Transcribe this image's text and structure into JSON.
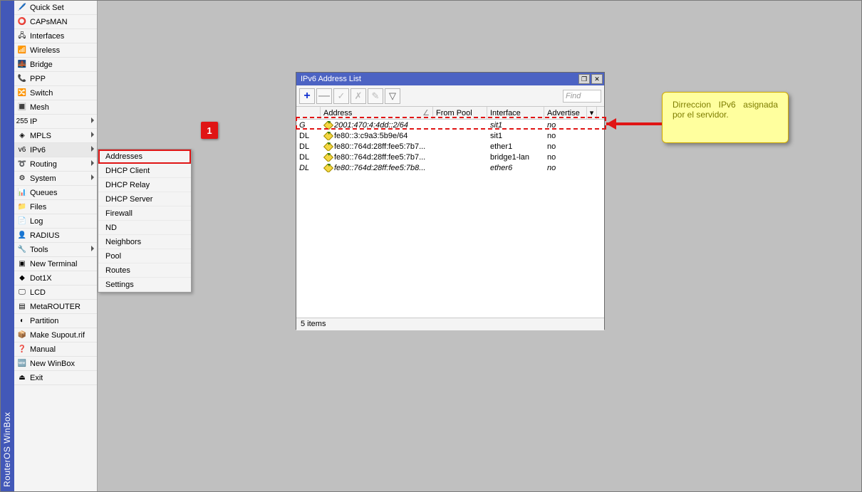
{
  "app_title": "RouterOS WinBox",
  "sidebar": {
    "items": [
      {
        "label": "Quick Set",
        "icon": "🖊️",
        "has_sub": false
      },
      {
        "label": "CAPsMAN",
        "icon": "⭕",
        "has_sub": false
      },
      {
        "label": "Interfaces",
        "icon": "🖧",
        "has_sub": false
      },
      {
        "label": "Wireless",
        "icon": "📶",
        "has_sub": false
      },
      {
        "label": "Bridge",
        "icon": "🌉",
        "has_sub": false
      },
      {
        "label": "PPP",
        "icon": "📞",
        "has_sub": false
      },
      {
        "label": "Switch",
        "icon": "🔀",
        "has_sub": false
      },
      {
        "label": "Mesh",
        "icon": "🔳",
        "has_sub": false
      },
      {
        "label": "IP",
        "icon": "255",
        "has_sub": true
      },
      {
        "label": "MPLS",
        "icon": "◈",
        "has_sub": true
      },
      {
        "label": "IPv6",
        "icon": "v6",
        "has_sub": true,
        "selected": true
      },
      {
        "label": "Routing",
        "icon": "➰",
        "has_sub": true
      },
      {
        "label": "System",
        "icon": "⚙",
        "has_sub": true
      },
      {
        "label": "Queues",
        "icon": "📊",
        "has_sub": false
      },
      {
        "label": "Files",
        "icon": "📁",
        "has_sub": false
      },
      {
        "label": "Log",
        "icon": "📄",
        "has_sub": false
      },
      {
        "label": "RADIUS",
        "icon": "👤",
        "has_sub": false
      },
      {
        "label": "Tools",
        "icon": "🔧",
        "has_sub": true
      },
      {
        "label": "New Terminal",
        "icon": "▣",
        "has_sub": false
      },
      {
        "label": "Dot1X",
        "icon": "◆",
        "has_sub": false
      },
      {
        "label": "LCD",
        "icon": "🖵",
        "has_sub": false
      },
      {
        "label": "MetaROUTER",
        "icon": "▤",
        "has_sub": false
      },
      {
        "label": "Partition",
        "icon": "◐",
        "has_sub": false
      },
      {
        "label": "Make Supout.rif",
        "icon": "📦",
        "has_sub": false
      },
      {
        "label": "Manual",
        "icon": "❓",
        "has_sub": false
      },
      {
        "label": "New WinBox",
        "icon": "🆕",
        "has_sub": false
      },
      {
        "label": "Exit",
        "icon": "⏏",
        "has_sub": false
      }
    ]
  },
  "submenu": {
    "items": [
      {
        "label": "Addresses",
        "highlight": true
      },
      {
        "label": "DHCP Client"
      },
      {
        "label": "DHCP Relay"
      },
      {
        "label": "DHCP Server"
      },
      {
        "label": "Firewall"
      },
      {
        "label": "ND"
      },
      {
        "label": "Neighbors"
      },
      {
        "label": "Pool"
      },
      {
        "label": "Routes"
      },
      {
        "label": "Settings"
      }
    ]
  },
  "ipwin": {
    "title": "IPv6 Address List",
    "find_placeholder": "Find",
    "columns": {
      "address": "Address",
      "from_pool": "From Pool",
      "interface": "Interface",
      "advertise": "Advertise"
    },
    "rows": [
      {
        "flag": "G",
        "address": "2001:470:4:4dd::2/64",
        "from_pool": "",
        "interface": "sit1",
        "advertise": "no",
        "italic": true
      },
      {
        "flag": "DL",
        "address": "fe80::3:c9a3:5b9e/64",
        "from_pool": "",
        "interface": "sit1",
        "advertise": "no"
      },
      {
        "flag": "DL",
        "address": "fe80::764d:28ff:fee5:7b7...",
        "from_pool": "",
        "interface": "ether1",
        "advertise": "no"
      },
      {
        "flag": "DL",
        "address": "fe80::764d:28ff:fee5:7b7...",
        "from_pool": "",
        "interface": "bridge1-lan",
        "advertise": "no"
      },
      {
        "flag": "DL",
        "address": "fe80::764d:28ff:fee5:7b8...",
        "from_pool": "",
        "interface": "ether6",
        "advertise": "no",
        "italic": true
      }
    ],
    "status": "5 items"
  },
  "marker_label": "1",
  "note_text": "Dirreccion IPv6 asignada por el servidor."
}
